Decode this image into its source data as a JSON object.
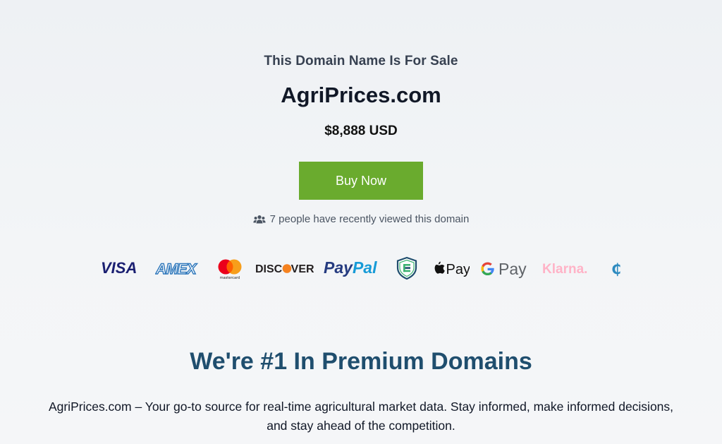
{
  "sale": {
    "heading": "This Domain Name Is For Sale",
    "domain": "AgriPrices.com",
    "price": "$8,888 USD",
    "buy_label": "Buy Now",
    "viewers_text": "7 people have recently viewed this domain"
  },
  "payments": [
    {
      "name": "visa-logo",
      "label": "VISA"
    },
    {
      "name": "amex-logo",
      "label": "AMEX"
    },
    {
      "name": "mastercard-logo",
      "label": "mastercard"
    },
    {
      "name": "discover-logo",
      "label": "DISCOVER"
    },
    {
      "name": "paypal-logo",
      "label": "PayPal"
    },
    {
      "name": "escrow-logo",
      "label": "Escrow"
    },
    {
      "name": "apple-pay-logo",
      "label": "Pay"
    },
    {
      "name": "google-pay-logo",
      "label": "Pay"
    },
    {
      "name": "klarna-logo",
      "label": "Klarna."
    },
    {
      "name": "crypto-logo",
      "label": "₵"
    }
  ],
  "promo": {
    "title": "We're #1 In Premium Domains",
    "description": "AgriPrices.com – Your go-to source for real-time agricultural market data. Stay informed, make informed decisions, and stay ahead of the competition."
  },
  "colors": {
    "buy_button": "#6aab2e",
    "promo_title": "#1f4e6e",
    "visa": "#1a1f71",
    "amex": "#2e77bb",
    "paypal_dark": "#253b80",
    "paypal_light": "#179bd7",
    "klarna": "#ffb3c7"
  }
}
